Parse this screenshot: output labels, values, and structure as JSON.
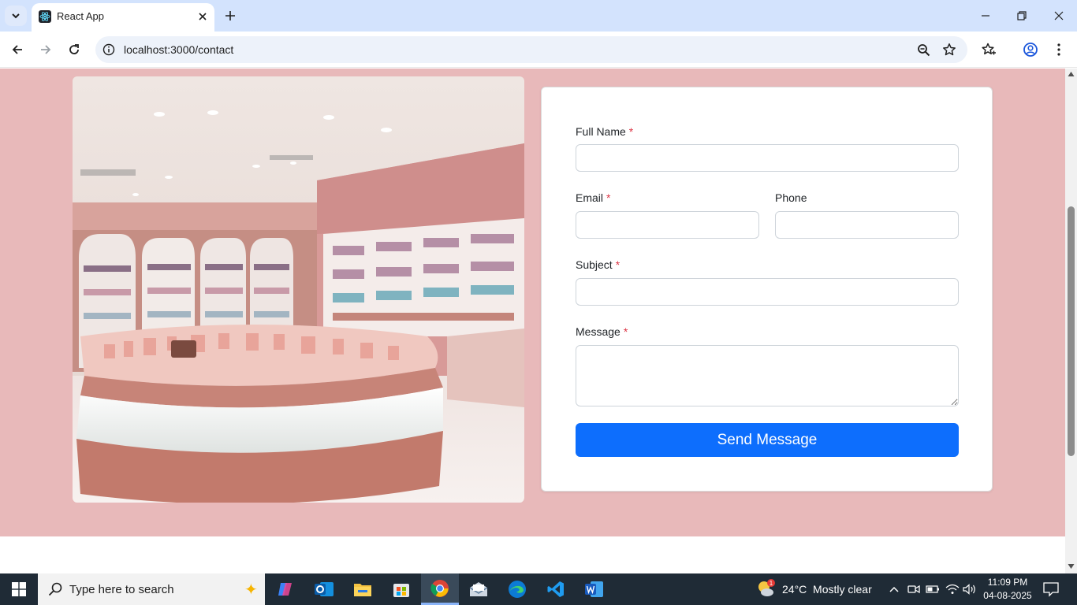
{
  "browser": {
    "tab_title": "React App",
    "url": "localhost:3000/contact"
  },
  "form": {
    "full_name_label": "Full Name",
    "email_label": "Email",
    "phone_label": "Phone",
    "subject_label": "Subject",
    "message_label": "Message",
    "required_marker": "*",
    "full_name_value": "",
    "email_value": "",
    "phone_value": "",
    "subject_value": "",
    "message_value": "",
    "submit_label": "Send Message"
  },
  "taskbar": {
    "search_placeholder": "Type here to search",
    "weather": "24°C  Mostly clear",
    "weather_badge": "1",
    "time": "11:09 PM",
    "date": "04-08-2025"
  },
  "colors": {
    "section_bg": "#e8b9ba",
    "primary_button": "#0d6efd",
    "required": "#dc3545",
    "tabstrip": "#d3e3fd",
    "taskbar": "#1f2b36"
  }
}
